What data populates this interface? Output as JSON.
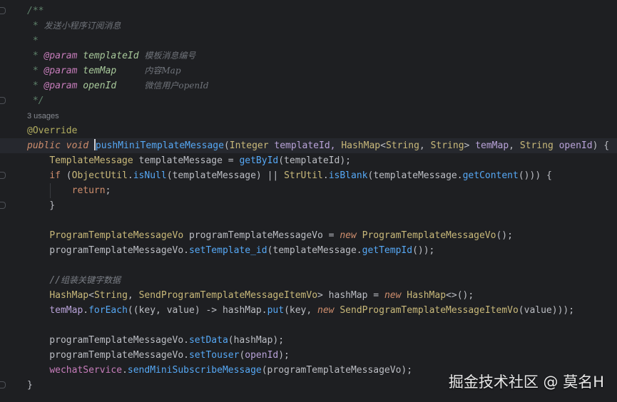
{
  "editor": {
    "language": "java",
    "background": "#1e1f22",
    "lines": [
      [
        {
          "t": "/**",
          "c": "doc"
        }
      ],
      [
        {
          "t": " * ",
          "c": "doc"
        },
        {
          "t": "发送小程序订阅消息",
          "c": "docdesc"
        }
      ],
      [
        {
          "t": " *",
          "c": "doc"
        }
      ],
      [
        {
          "t": " * ",
          "c": "doc"
        },
        {
          "t": "@param",
          "c": "doctag"
        },
        {
          "t": " ",
          "c": "doc"
        },
        {
          "t": "templateId",
          "c": "docparam"
        },
        {
          "t": " ",
          "c": "doc"
        },
        {
          "t": "模板消息编号",
          "c": "docdesc"
        }
      ],
      [
        {
          "t": " * ",
          "c": "doc"
        },
        {
          "t": "@param",
          "c": "doctag"
        },
        {
          "t": " ",
          "c": "doc"
        },
        {
          "t": "temMap",
          "c": "docparam"
        },
        {
          "t": "     ",
          "c": "doc"
        },
        {
          "t": "内容Map",
          "c": "docdesc"
        }
      ],
      [
        {
          "t": " * ",
          "c": "doc"
        },
        {
          "t": "@param",
          "c": "doctag"
        },
        {
          "t": " ",
          "c": "doc"
        },
        {
          "t": "openId",
          "c": "docparam"
        },
        {
          "t": "     ",
          "c": "doc"
        },
        {
          "t": "微信用户openId",
          "c": "docdesc"
        }
      ],
      [
        {
          "t": " */",
          "c": "doc"
        }
      ],
      [
        {
          "t": "3 usages",
          "c": "usages"
        }
      ],
      [
        {
          "t": "@Override",
          "c": "annot"
        }
      ],
      [
        {
          "t": "public void ",
          "c": "kwi"
        },
        {
          "t": "CARET",
          "c": "caret"
        },
        {
          "t": "pushMiniTemplateMessage",
          "c": "fn"
        },
        {
          "t": "(",
          "c": "plain"
        },
        {
          "t": "Integer",
          "c": "type"
        },
        {
          "t": " templateId, ",
          "c": "param"
        },
        {
          "t": "HashMap",
          "c": "type"
        },
        {
          "t": "<",
          "c": "plain"
        },
        {
          "t": "String",
          "c": "type"
        },
        {
          "t": ", ",
          "c": "plain"
        },
        {
          "t": "String",
          "c": "type"
        },
        {
          "t": "> ",
          "c": "plain"
        },
        {
          "t": "temMap",
          "c": "param"
        },
        {
          "t": ", ",
          "c": "plain"
        },
        {
          "t": "String",
          "c": "type"
        },
        {
          "t": " openId",
          "c": "param"
        },
        {
          "t": ") {",
          "c": "plain"
        }
      ],
      [
        {
          "t": "    ",
          "c": "plain"
        },
        {
          "t": "TemplateMessage",
          "c": "type"
        },
        {
          "t": " templateMessage = ",
          "c": "plain"
        },
        {
          "t": "getById",
          "c": "fn"
        },
        {
          "t": "(templateId);",
          "c": "plain"
        }
      ],
      [
        {
          "t": "    ",
          "c": "plain"
        },
        {
          "t": "if",
          "c": "kw"
        },
        {
          "t": " (",
          "c": "plain"
        },
        {
          "t": "ObjectUtil",
          "c": "type"
        },
        {
          "t": ".",
          "c": "plain"
        },
        {
          "t": "isNull",
          "c": "fn"
        },
        {
          "t": "(templateMessage) || ",
          "c": "plain"
        },
        {
          "t": "StrUtil",
          "c": "type"
        },
        {
          "t": ".",
          "c": "plain"
        },
        {
          "t": "isBlank",
          "c": "fn"
        },
        {
          "t": "(templateMessage.",
          "c": "plain"
        },
        {
          "t": "getContent",
          "c": "fn"
        },
        {
          "t": "())) {",
          "c": "plain"
        }
      ],
      [
        {
          "t": "        ",
          "c": "plain"
        },
        {
          "t": "return",
          "c": "kw"
        },
        {
          "t": ";",
          "c": "plain"
        }
      ],
      [
        {
          "t": "    }",
          "c": "plain"
        }
      ],
      [],
      [
        {
          "t": "    ",
          "c": "plain"
        },
        {
          "t": "ProgramTemplateMessageVo",
          "c": "type"
        },
        {
          "t": " programTemplateMessageVo = ",
          "c": "plain"
        },
        {
          "t": "new",
          "c": "kwi"
        },
        {
          "t": " ",
          "c": "plain"
        },
        {
          "t": "ProgramTemplateMessageVo",
          "c": "type"
        },
        {
          "t": "();",
          "c": "plain"
        }
      ],
      [
        {
          "t": "    programTemplateMessageVo.",
          "c": "plain"
        },
        {
          "t": "setTemplate_id",
          "c": "fn"
        },
        {
          "t": "(templateMessage.",
          "c": "plain"
        },
        {
          "t": "getTempId",
          "c": "fn"
        },
        {
          "t": "());",
          "c": "plain"
        }
      ],
      [],
      [
        {
          "t": "    ",
          "c": "plain"
        },
        {
          "t": "//",
          "c": "comment"
        },
        {
          "t": "组装关键字数据",
          "c": "cjk"
        }
      ],
      [
        {
          "t": "    ",
          "c": "plain"
        },
        {
          "t": "HashMap",
          "c": "type"
        },
        {
          "t": "<",
          "c": "plain"
        },
        {
          "t": "String",
          "c": "type"
        },
        {
          "t": ", ",
          "c": "plain"
        },
        {
          "t": "SendProgramTemplateMessageItemVo",
          "c": "type"
        },
        {
          "t": "> hashMap = ",
          "c": "plain"
        },
        {
          "t": "new",
          "c": "kwi"
        },
        {
          "t": " ",
          "c": "plain"
        },
        {
          "t": "HashMap",
          "c": "type"
        },
        {
          "t": "<>();",
          "c": "plain"
        }
      ],
      [
        {
          "t": "    ",
          "c": "plain"
        },
        {
          "t": "temMap",
          "c": "param"
        },
        {
          "t": ".",
          "c": "plain"
        },
        {
          "t": "forEach",
          "c": "fn"
        },
        {
          "t": "((key, value) -> hashMap.",
          "c": "plain"
        },
        {
          "t": "put",
          "c": "fn"
        },
        {
          "t": "(key, ",
          "c": "plain"
        },
        {
          "t": "new",
          "c": "kwi"
        },
        {
          "t": " ",
          "c": "plain"
        },
        {
          "t": "SendProgramTemplateMessageItemVo",
          "c": "type"
        },
        {
          "t": "(value)));",
          "c": "plain"
        }
      ],
      [],
      [
        {
          "t": "    programTemplateMessageVo.",
          "c": "plain"
        },
        {
          "t": "setData",
          "c": "fn"
        },
        {
          "t": "(hashMap);",
          "c": "plain"
        }
      ],
      [
        {
          "t": "    programTemplateMessageVo.",
          "c": "plain"
        },
        {
          "t": "setTouser",
          "c": "fn"
        },
        {
          "t": "(",
          "c": "plain"
        },
        {
          "t": "openId",
          "c": "param"
        },
        {
          "t": ");",
          "c": "plain"
        }
      ],
      [
        {
          "t": "    ",
          "c": "plain"
        },
        {
          "t": "wechatService",
          "c": "field"
        },
        {
          "t": ".",
          "c": "plain"
        },
        {
          "t": "sendMiniSubscribeMessage",
          "c": "fn"
        },
        {
          "t": "(programTemplateMessageVo);",
          "c": "plain"
        }
      ],
      [
        {
          "t": "}",
          "c": "plain"
        }
      ]
    ]
  },
  "watermark": "掘金技术社区 @ 莫名H"
}
